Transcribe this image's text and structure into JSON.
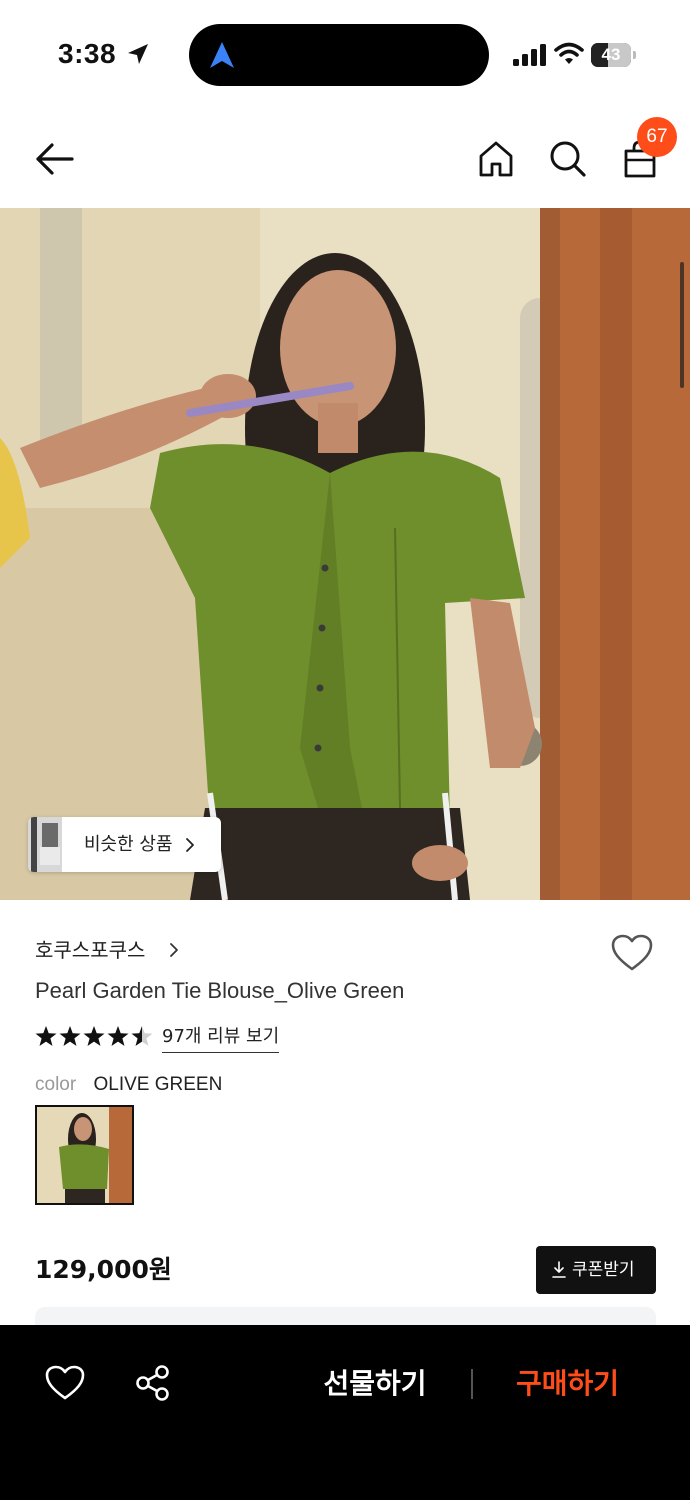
{
  "status_bar": {
    "time": "3:38",
    "battery_level": "43",
    "battery_fraction": 0.43
  },
  "header": {
    "icons": [
      "back-arrow-icon",
      "home-icon",
      "search-icon",
      "shopping-bag-icon"
    ],
    "cart_count": "67"
  },
  "product_image": {
    "similar_products_label": "비슷한 상품"
  },
  "product": {
    "brand": "호쿠스포쿠스",
    "name": "Pearl Garden Tie Blouse_Olive Green",
    "rating": 4.5,
    "review_link": "97개 리뷰 보기",
    "color_label": "color",
    "color_value": "OLIVE GREEN",
    "price": "129,000원",
    "coupon_label": "쿠폰받기"
  },
  "bottom_bar": {
    "gift_label": "선물하기",
    "buy_label": "구매하기"
  },
  "colors": {
    "accent": "#ff4d1a",
    "blouse": "#6f8e2c",
    "bottom_bar": "#000000"
  }
}
